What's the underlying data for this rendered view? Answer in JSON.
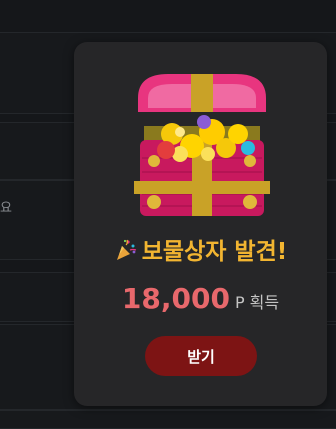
{
  "background": {
    "partial_text": "요"
  },
  "modal": {
    "title": "보물상자 발견!",
    "reward_amount": "18,000",
    "reward_unit": "P 획득",
    "claim_label": "받기",
    "icons": {
      "illustration": "treasure-chest-icon",
      "title_icon": "party-popper-icon"
    }
  },
  "colors": {
    "title": "#f2b531",
    "reward_amount": "#e8686c",
    "button": "#7d1414",
    "modal_bg": "#262628"
  }
}
